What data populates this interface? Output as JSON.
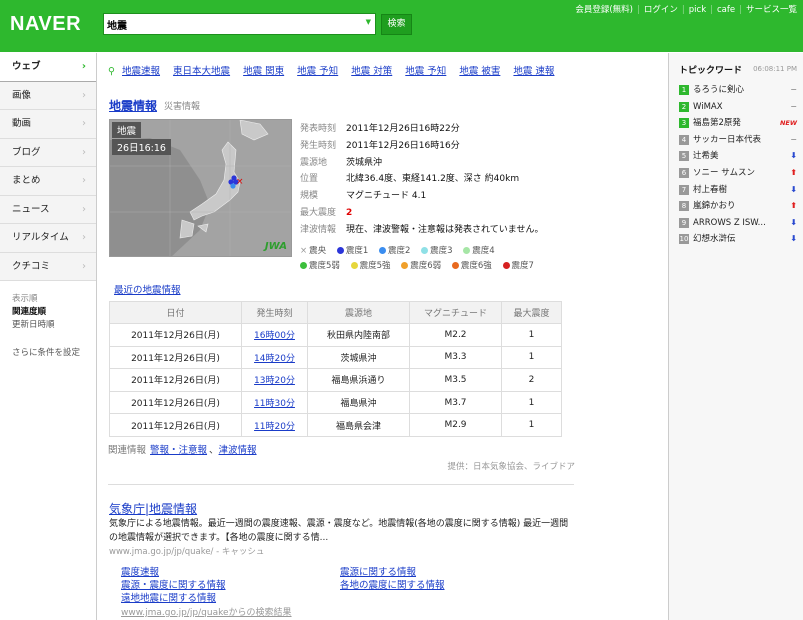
{
  "header": {
    "logo": "NAVER",
    "search_value": "地震",
    "search_button": "検索",
    "top_links": [
      "会員登録(無料)",
      "ログイン",
      "pick",
      "cafe",
      "サービス一覧"
    ]
  },
  "sidebar": {
    "items": [
      {
        "label": "ウェブ",
        "active": true
      },
      {
        "label": "画像"
      },
      {
        "label": "動画"
      },
      {
        "label": "ブログ"
      },
      {
        "label": "まとめ"
      },
      {
        "label": "ニュース"
      },
      {
        "label": "リアルタイム"
      },
      {
        "label": "クチコミ"
      }
    ],
    "sort_title": "表示順",
    "sort_relevance": "関連度順",
    "sort_date": "更新日時順",
    "more_conditions": "さらに条件を設定"
  },
  "related": [
    "地震速報",
    "東日本大地震",
    "地震 関東",
    "地震 予知",
    "地震 対策",
    "地震 予知",
    "地震 被害",
    "地震 速報"
  ],
  "quake": {
    "title": "地震情報",
    "subtitle": "災害情報",
    "map_label1": "地震",
    "map_label2": "26日16:16",
    "map_logo": "JWA",
    "info": [
      {
        "k": "発表時刻",
        "v": "2011年12月26日16時22分"
      },
      {
        "k": "発生時刻",
        "v": "2011年12月26日16時16分"
      },
      {
        "k": "震源地",
        "v": "茨城県沖"
      },
      {
        "k": "位置",
        "v": "北緯36.4度、東経141.2度、深さ 約40km"
      },
      {
        "k": "規模",
        "v": "マグニチュード 4.1"
      },
      {
        "k": "最大震度",
        "v": "2"
      },
      {
        "k": "津波情報",
        "v": "現在、津波警報・注意報は発表されていません。"
      }
    ],
    "legend_row1": [
      {
        "label": "震央",
        "mark": "x"
      },
      {
        "label": "震度1",
        "color": "#2b35d9"
      },
      {
        "label": "震度2",
        "color": "#3a8df0"
      },
      {
        "label": "震度3",
        "color": "#8fe0e6"
      },
      {
        "label": "震度4",
        "color": "#a6e6a6"
      }
    ],
    "legend_row2": [
      {
        "label": "震度5弱",
        "color": "#3cbf3c"
      },
      {
        "label": "震度5強",
        "color": "#e6d63c"
      },
      {
        "label": "震度6弱",
        "color": "#f0a02b"
      },
      {
        "label": "震度6強",
        "color": "#e8691e"
      },
      {
        "label": "震度7",
        "color": "#d62020"
      }
    ]
  },
  "recent_link": "最近の地震情報",
  "table": {
    "headers": [
      "日付",
      "発生時刻",
      "震源地",
      "マグニチュード",
      "最大震度"
    ],
    "rows": [
      [
        "2011年12月26日(月)",
        "16時00分",
        "秋田県内陸南部",
        "M2.2",
        "1"
      ],
      [
        "2011年12月26日(月)",
        "14時20分",
        "茨城県沖",
        "M3.3",
        "1"
      ],
      [
        "2011年12月26日(月)",
        "13時20分",
        "福島県浜通り",
        "M3.5",
        "2"
      ],
      [
        "2011年12月26日(月)",
        "11時30分",
        "福島県沖",
        "M3.7",
        "1"
      ],
      [
        "2011年12月26日(月)",
        "11時20分",
        "福島県会津",
        "M2.9",
        "1"
      ]
    ]
  },
  "kanren": {
    "label": "関連情報",
    "link1": "警報・注意報",
    "sep": "、",
    "link2": "津波情報"
  },
  "provider": "提供：日本気象協会、ライブドア",
  "result": {
    "title": "気象庁|地震情報",
    "desc1": "気象庁による地震情報。最近一週間の震度速報、震源・震度など。地震情報(各地の震度に関する情報) 最近一週間",
    "desc2": "の地震情報が選択できます。【各地の震度に関する情...",
    "url": "www.jma.go.jp/jp/quake/ - キャッシュ",
    "sublinks": [
      "震度速報",
      "震源に関する情報",
      "震源・震度に関する情報",
      "各地の震度に関する情報",
      "遠地地震に関する情報"
    ],
    "sub_url": "www.jma.go.jp/jp/quakeからの検索結果"
  },
  "topics": {
    "title": "トピックワード",
    "time": "06:08:11 PM",
    "items": [
      {
        "rank": "1",
        "word": "るろうに剣心",
        "move": "same"
      },
      {
        "rank": "2",
        "word": "WiMAX",
        "move": "same"
      },
      {
        "rank": "3",
        "word": "福島第2原発",
        "move": "new"
      },
      {
        "rank": "4",
        "word": "サッカー日本代表",
        "move": "same"
      },
      {
        "rank": "5",
        "word": "辻希美",
        "move": "down"
      },
      {
        "rank": "6",
        "word": "ソニー サムスン",
        "move": "up"
      },
      {
        "rank": "7",
        "word": "村上春樹",
        "move": "down"
      },
      {
        "rank": "8",
        "word": "嵐錦かおり",
        "move": "up"
      },
      {
        "rank": "9",
        "word": "ARROWS Z ISW...",
        "move": "down"
      },
      {
        "rank": "10",
        "word": "幻想水滸伝",
        "move": "down"
      }
    ],
    "moves": {
      "same": "−",
      "up": "⬆",
      "down": "⬇",
      "new": "NEW"
    }
  }
}
